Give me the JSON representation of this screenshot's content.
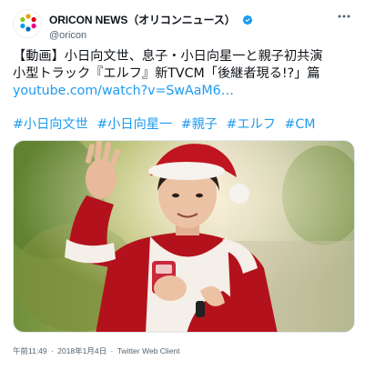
{
  "account": {
    "display_name": "ORICON NEWS（オリコンニュース）",
    "handle": "@oricon",
    "verified": true,
    "avatar_icon": "oricon-logo-icon"
  },
  "more_icon": "ellipsis-icon",
  "tweet": {
    "lines": [
      "【動画】小日向文世、息子・小日向星一と親子初共演",
      "小型トラック『エルフ』新TVCM「後継者現る!?」篇"
    ],
    "link_text": "youtube.com/watch?v=SwAaM6…",
    "hashtags": [
      "#小日向文世",
      "#小日向星一",
      "#親子",
      "#エルフ",
      "#CM"
    ]
  },
  "media": {
    "kind": "video-thumbnail"
  },
  "meta": {
    "time": "午前11:49",
    "separator": "·",
    "date": "2018年1月4日",
    "client": "Twitter Web Client"
  },
  "colors": {
    "accent": "#1d9bf0",
    "text": "#0f1419",
    "secondary": "#536471"
  }
}
